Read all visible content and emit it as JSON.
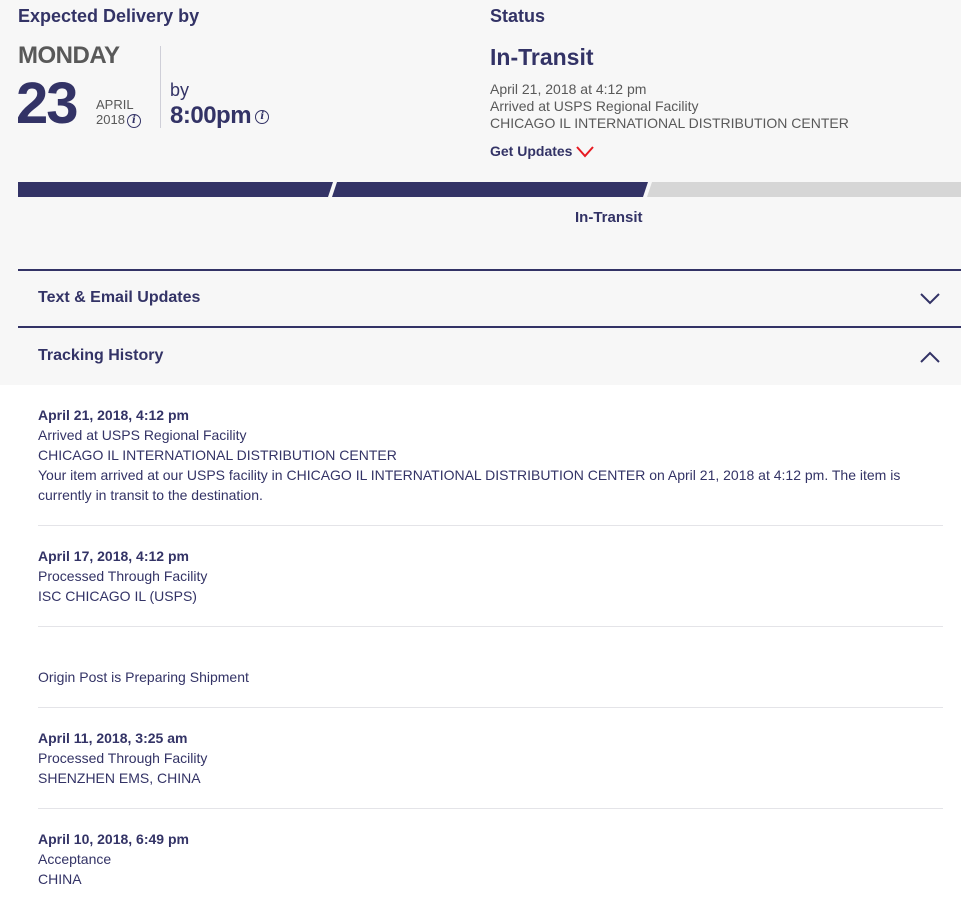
{
  "delivery": {
    "label": "Expected Delivery by",
    "day_name": "MONDAY",
    "day_number": "23",
    "month": "APRIL",
    "year": "2018",
    "by_label": "by",
    "time": "8:00pm",
    "info_glyph": "i"
  },
  "status": {
    "label": "Status",
    "value": "In-Transit",
    "line1": "April 21, 2018 at 4:12 pm",
    "line2": "Arrived at USPS Regional Facility",
    "line3": "CHICAGO IL INTERNATIONAL DISTRIBUTION CENTER",
    "get_updates_label": "Get Updates",
    "accent_color": "#e71921"
  },
  "progress": {
    "label": "In-Transit",
    "segments_completed": 2,
    "segments_total": 3,
    "filled_color": "#333366",
    "empty_color": "#d6d6d6"
  },
  "sections": {
    "text_email": {
      "label": "Text & Email Updates",
      "expanded": false
    },
    "tracking_history": {
      "label": "Tracking History",
      "expanded": true
    }
  },
  "history": [
    {
      "date": "April 21, 2018, 4:12 pm",
      "lines": [
        "Arrived at USPS Regional Facility",
        "CHICAGO IL INTERNATIONAL DISTRIBUTION CENTER",
        "Your item arrived at our USPS facility in CHICAGO IL INTERNATIONAL DISTRIBUTION CENTER on April 21, 2018 at 4:12 pm. The item is currently in transit to the destination."
      ]
    },
    {
      "date": "April 17, 2018, 4:12 pm",
      "lines": [
        "Processed Through Facility",
        "ISC CHICAGO IL (USPS)"
      ]
    },
    {
      "date": "",
      "lines": [
        "Origin Post is Preparing Shipment"
      ]
    },
    {
      "date": "April 11, 2018, 3:25 am",
      "lines": [
        "Processed Through Facility",
        "SHENZHEN EMS, CHINA"
      ]
    },
    {
      "date": "April 10, 2018, 6:49 pm",
      "lines": [
        "Acceptance",
        "CHINA"
      ]
    }
  ]
}
